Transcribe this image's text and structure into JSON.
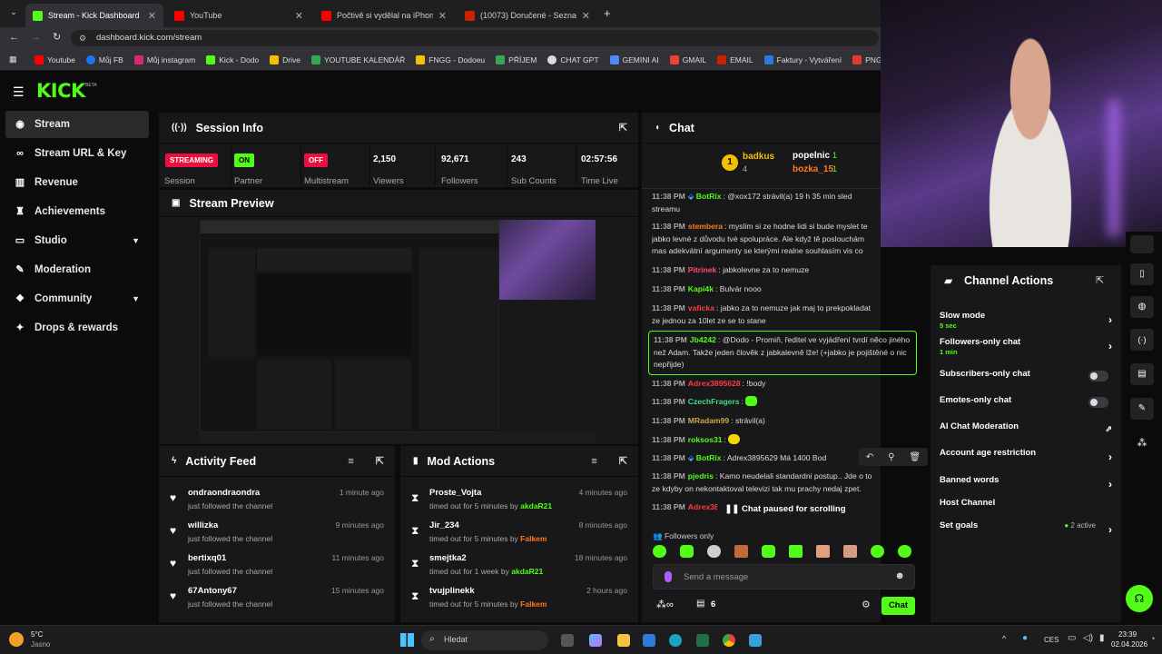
{
  "browser": {
    "tabs": [
      {
        "title": "Stream - Kick Dashboard",
        "active": true,
        "color": "#53fc18"
      },
      {
        "title": "YouTube",
        "active": false,
        "color": "#ff0000"
      },
      {
        "title": "Počtivě si vydělal na iPhone, po",
        "active": false,
        "color": "#ff0000"
      },
      {
        "title": "(10073) Doručené - Seznam Em",
        "active": false,
        "color": "#cc2200"
      }
    ],
    "url": "dashboard.kick.com/stream",
    "bookmarks": [
      "Youtube",
      "Můj FB",
      "Můj instagram",
      "Kick - Dodo",
      "Drive",
      "YOUTUBE KALENDÁŘ",
      "FNGG - Dodoeu",
      "PŘÍJEM",
      "CHAT GPT",
      "GEMINI AI",
      "GMAIL",
      "EMAIL",
      "Faktury - Vytváření",
      "PNG to PDF"
    ]
  },
  "brand": {
    "logo": "KICK",
    "beta": "BETA",
    "accent": "#53fc18"
  },
  "sidebar": {
    "items": [
      {
        "label": "Stream",
        "icon": "broadcast-icon",
        "active": true
      },
      {
        "label": "Stream URL & Key",
        "icon": "link-icon"
      },
      {
        "label": "Revenue",
        "icon": "chart-icon"
      },
      {
        "label": "Achievements",
        "icon": "trophy-icon"
      },
      {
        "label": "Studio",
        "icon": "studio-icon",
        "expandable": true
      },
      {
        "label": "Moderation",
        "icon": "wrench-icon"
      },
      {
        "label": "Community",
        "icon": "community-icon",
        "expandable": true
      },
      {
        "label": "Drops & rewards",
        "icon": "gift-icon"
      }
    ]
  },
  "session": {
    "title": "Session Info",
    "cells": [
      {
        "badge": "STREAMING",
        "badge_color": "#e9113c",
        "label": "Session"
      },
      {
        "badge": "ON",
        "badge_color": "#53fc18",
        "label": "Partner"
      },
      {
        "badge": "OFF",
        "badge_color": "#e9113c",
        "label": "Multistream"
      },
      {
        "value": "2,150",
        "label": "Viewers"
      },
      {
        "value": "92,671",
        "label": "Followers"
      },
      {
        "value": "243",
        "label": "Sub Counts"
      },
      {
        "value": "02:57:56",
        "label": "Time Live"
      }
    ]
  },
  "preview": {
    "title": "Stream Preview"
  },
  "activity": {
    "title": "Activity Feed",
    "rows": [
      {
        "name": "ondraondraondra",
        "sub": "just followed the channel",
        "time": "1 minute ago"
      },
      {
        "name": "willizka",
        "sub": "just followed the channel",
        "time": "9 minutes ago"
      },
      {
        "name": "bertixq01",
        "sub": "just followed the channel",
        "time": "11 minutes ago"
      },
      {
        "name": "67Antony67",
        "sub": "just followed the channel",
        "time": "15 minutes ago"
      }
    ]
  },
  "modactions": {
    "title": "Mod Actions",
    "rows": [
      {
        "name": "Proste_Vojta",
        "sub": "timed out for 5 minutes by",
        "by": "akdaR21",
        "time": "4 minutes ago"
      },
      {
        "name": "Jir_234",
        "sub": "timed out for 5 minutes by",
        "by": "Falkem",
        "time": "8 minutes ago"
      },
      {
        "name": "smejtka2",
        "sub": "timed out for 1 week by",
        "by": "akdaR21",
        "time": "18 minutes ago"
      },
      {
        "name": "tvujplinekk",
        "sub": "timed out for 5 minutes by",
        "by": "Falkem",
        "time": "2 hours ago"
      }
    ]
  },
  "chat": {
    "title": "Chat",
    "leaders": [
      {
        "rank": "1",
        "name": "badkus",
        "count": "4"
      },
      {
        "name": "popelnic",
        "count": "1"
      },
      {
        "name": "bozka_15",
        "count": "1"
      }
    ],
    "messages": [
      {
        "time": "11:38 PM",
        "user": "BotRix",
        "color": "#53fc18",
        "text": "@xox172 strávil(a) 19 h 35 min sled streamu"
      },
      {
        "time": "11:38 PM",
        "user": "stembera",
        "color": "#ff7a1a",
        "text": "myslim si ze hodne lidi si bude myslet te jabko levné z důvodu tvé spolupráce. Ale když tě poslouchám mas adekvátní argumenty se kterými realne souhlasím vis co"
      },
      {
        "time": "11:38 PM",
        "user": "Pitrinek",
        "color": "#ff4d6d",
        "text": "jabkolevne za to nemuze"
      },
      {
        "time": "11:38 PM",
        "user": "Kapi4k",
        "color": "#53fc18",
        "text": "Bulvár nooo"
      },
      {
        "time": "11:38 PM",
        "user": "vaficka",
        "color": "#ff3b3b",
        "text": "jabko za to nemuze jak maj to prekpokladat ze jednou za 10let ze se to stane"
      },
      {
        "time": "11:38 PM",
        "user": "Jb4242",
        "color": "#53fc18",
        "text": "@Dodo - Promiň, ředitel ve vyjádření tvrdí něco jiného než Adam. Takže jeden člověk z jabkalevně lže! (+jabko je pojištěné o nic nepřijde)"
      },
      {
        "time": "11:38 PM",
        "user": "Adrex3895628",
        "color": "#ff3b3b",
        "text": "!body"
      },
      {
        "time": "11:38 PM",
        "user": "CzechFragers",
        "color": "#3ddc84",
        "text": ""
      },
      {
        "time": "11:38 PM",
        "user": "MRadam99",
        "color": "#c9a84a",
        "text": "strávil(a)"
      },
      {
        "time": "11:38 PM",
        "user": "roksos31",
        "color": "#53fc18",
        "text": ""
      },
      {
        "time": "11:38 PM",
        "user": "BotRix",
        "color": "#53fc18",
        "text": "Adrex3895629 Má 1400 Bod"
      },
      {
        "time": "11:38 PM",
        "user": "pjedris",
        "color": "#53fc18",
        "text": "Kamo neudelali standardni postup.. Jde o to ze kdyby on nekontaktoval televizi tak mu prachy nedaj zpet."
      },
      {
        "time": "11:38 PM",
        "user": "Adrex38",
        "color": "#ff3b3b",
        "text": ""
      }
    ],
    "paused": "Chat paused for scrolling",
    "followers_only": "Followers only",
    "placeholder": "Send a message",
    "viewers": "6",
    "send": "Chat"
  },
  "channel_actions": {
    "title": "Channel Actions",
    "items": [
      {
        "label": "Slow mode",
        "sub": "5 sec",
        "control": "chevron"
      },
      {
        "label": "Followers-only chat",
        "sub": "1 min",
        "control": "chevron"
      },
      {
        "label": "Subscribers-only chat",
        "control": "toggle"
      },
      {
        "label": "Emotes-only chat",
        "control": "toggle"
      },
      {
        "label": "AI Chat Moderation",
        "control": "external"
      },
      {
        "label": "Account age restriction",
        "control": "chevron"
      },
      {
        "label": "Banned words",
        "control": "chevron"
      },
      {
        "label": "Host Channel",
        "control": "none"
      },
      {
        "label": "Set goals",
        "extra": "2 active",
        "control": "chevron"
      }
    ]
  },
  "taskbar": {
    "weather_temp": "5°C",
    "weather_desc": "Jasno",
    "search": "Hledat",
    "lang": "CES",
    "time": "23:39",
    "date": "02.04.2026"
  }
}
